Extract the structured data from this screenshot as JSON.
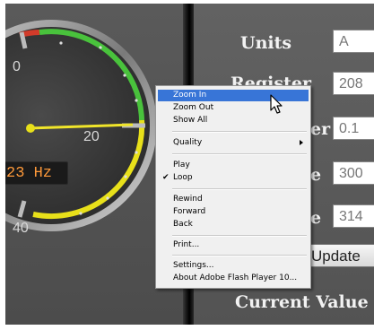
{
  "gauge": {
    "frequency_readout": "23 Hz",
    "tick_labels": {
      "upper_left": "0",
      "right": "20",
      "lower_left": "40"
    }
  },
  "form": {
    "labels": {
      "units": "Units",
      "register": "Register",
      "row3": "er",
      "row4": "e",
      "row5": "e",
      "current_value": "Current Value"
    },
    "values": {
      "units": "A",
      "register": "208",
      "row3": "0.1",
      "row4": "300",
      "row5": "314"
    },
    "update_button": "Update"
  },
  "context_menu": {
    "items": [
      {
        "label": "Zoom In",
        "highlighted": true
      },
      {
        "label": "Zoom Out"
      },
      {
        "label": "Show All"
      },
      {
        "label": "Quality",
        "submenu": true
      },
      {
        "label": "Play"
      },
      {
        "label": "Loop",
        "checked": true
      },
      {
        "label": "Rewind"
      },
      {
        "label": "Forward"
      },
      {
        "label": "Back"
      },
      {
        "label": "Print..."
      },
      {
        "label": "Settings..."
      },
      {
        "label": "About Adobe Flash Player 10..."
      }
    ],
    "check_glyph": "✔"
  },
  "colors": {
    "gauge_green": "#49c23c",
    "gauge_yellow": "#e8e01a",
    "gauge_red": "#d23b2a",
    "readout_text": "#ff9a3a",
    "menu_highlight": "#3875d7"
  },
  "icons": {
    "cursor": "arrow-pointer-icon",
    "submenu": "submenu-arrow-icon",
    "check": "check-icon"
  }
}
